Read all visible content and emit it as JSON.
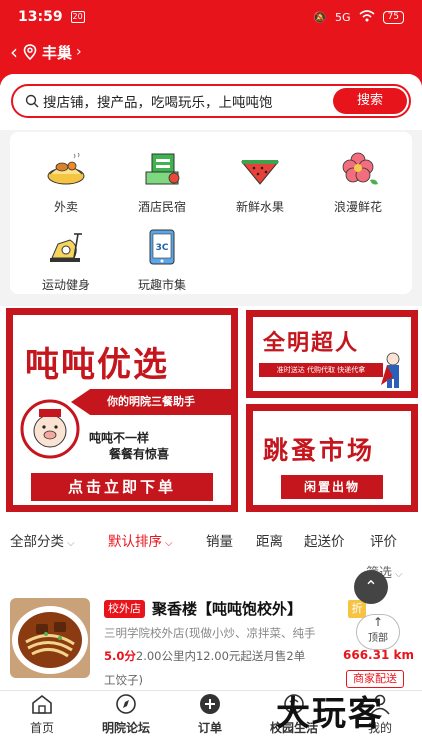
{
  "status_bar": {
    "time": "13:59",
    "mini_icon": "20",
    "battery": "75",
    "network": "5G",
    "wifi": "wifi-icon",
    "bell": "bell-mute-icon"
  },
  "header": {
    "city": "丰巢",
    "accent_color": "#e8141c"
  },
  "search": {
    "placeholder": "搜店铺，搜产品，吃喝玩乐，上吨吨饱",
    "button": "搜索"
  },
  "categories": [
    {
      "label": "外卖",
      "icon": "food-icon"
    },
    {
      "label": "酒店民宿",
      "icon": "hotel-icon"
    },
    {
      "label": "新鲜水果",
      "icon": "watermelon-icon"
    },
    {
      "label": "浪漫鲜花",
      "icon": "flower-icon"
    },
    {
      "label": "运动健身",
      "icon": "exercise-bike-icon"
    },
    {
      "label": "玩趣市集",
      "icon": "3c-market-icon"
    }
  ],
  "banners": {
    "left": {
      "title": "吨吨优选",
      "arrow_text": "你的明院三餐助手",
      "line1": "吨吨不一样",
      "line2": "餐餐有惊喜",
      "button": "点击立即下单"
    },
    "right_top": {
      "title": "全明超人",
      "strip_text": "准时送达 代购代取 快递代拿"
    },
    "right_bottom": {
      "title": "跳蚤市场",
      "button": "闲置出物"
    }
  },
  "sort_bar": {
    "items": [
      "全部分类",
      "默认排序",
      "销量",
      "距离",
      "起送价",
      "评价"
    ],
    "filter": "筛选"
  },
  "shop": {
    "tag": "校外店",
    "name": "聚香楼【吨吨饱校外】",
    "discount_tag": "折",
    "desc": "三明学院校外店(现做小炒、凉拌菜、纯手",
    "score": "5.0分",
    "meta": "2.00公里内12.00元起送月售2单",
    "meta2": "工饺子)",
    "distance": "666.31 km",
    "delivery": "商家配送"
  },
  "float": {
    "up": "^",
    "top_label": "顶部"
  },
  "bottom_nav": [
    {
      "label": "首页",
      "icon": "home-icon"
    },
    {
      "label": "明院论坛",
      "icon": "compass-icon"
    },
    {
      "label": "订单",
      "icon": "plus-circle-icon"
    },
    {
      "label": "校园生活",
      "icon": "life-icon"
    },
    {
      "label": "我的",
      "icon": "user-icon"
    }
  ],
  "watermark": "大玩客"
}
